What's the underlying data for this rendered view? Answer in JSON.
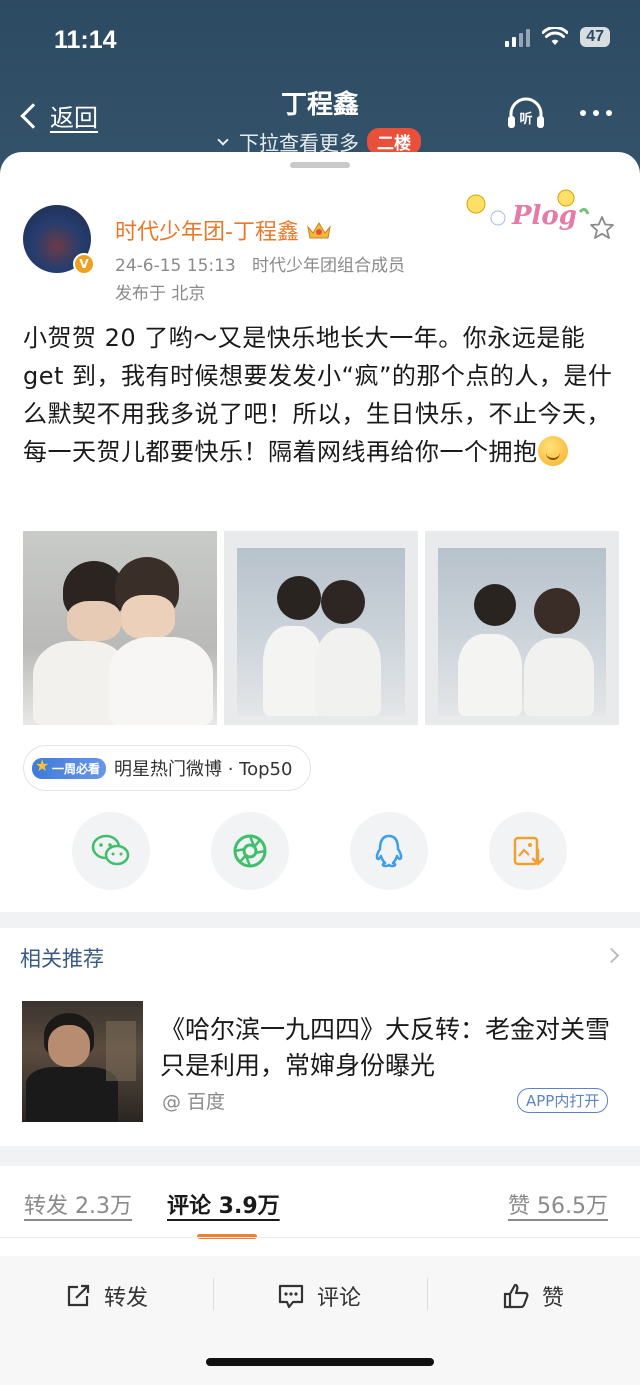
{
  "status": {
    "time": "11:14",
    "battery": "47"
  },
  "nav": {
    "back_label": "返回",
    "title": "丁程鑫",
    "subtitle": "下拉查看更多",
    "floor_badge": "二楼"
  },
  "post": {
    "username": "时代少年团-丁程鑫",
    "date": "24-6-15 15:13",
    "source": "时代少年团组合成员",
    "location": "发布于 北京",
    "text": "小贺贺 20 了哟～又是快乐地长大一年。你永远是能 get 到，我有时候想要发发小“疯”的那个点的人，是什么默契不用我多说了吧！所以，生日快乐，不止今天，每一天贺儿都要快乐！隔着网线再给你一个拥抱",
    "hot_pill": "一周必看",
    "hot_text": "明星热门微博 · Top50"
  },
  "related": {
    "heading": "相关推荐",
    "title": "《哈尔滨一九四四》大反转：老金对关雪只是利用，常婶身份曝光",
    "source": "@ 百度",
    "open_label": "APP内打开"
  },
  "tabs": {
    "repost": "转发 2.3万",
    "comment": "评论 3.9万",
    "like": "赞 56.5万"
  },
  "actions": {
    "repost": "转发",
    "comment": "评论",
    "like": "赞"
  },
  "colors": {
    "header_bg": "#2c4b63",
    "username": "#e8792a",
    "link_blue": "#3a5a85",
    "tab_indicator": "#f08030",
    "badge_red": "#e8503a"
  }
}
